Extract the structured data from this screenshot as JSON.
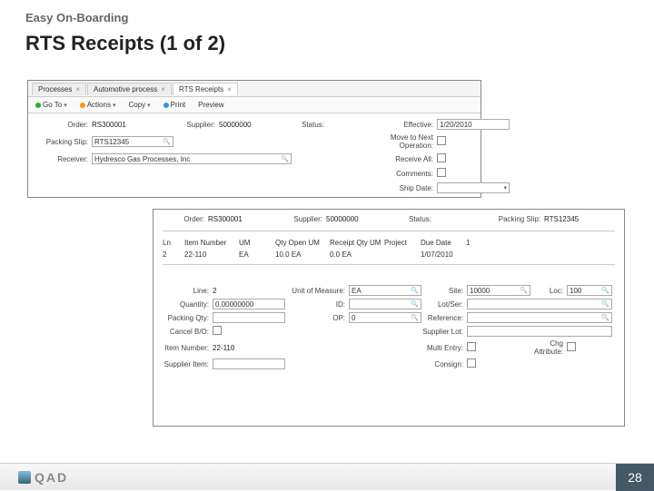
{
  "slide": {
    "header": "Easy On-Boarding",
    "title": "RTS Receipts (1 of 2)"
  },
  "panel1": {
    "tabs": [
      {
        "label": "Processes"
      },
      {
        "label": "Automotive process"
      },
      {
        "label": "RTS Receipts"
      }
    ],
    "toolbar": {
      "goto": "Go To",
      "actions": "Actions",
      "copy": "Copy",
      "print": "Print",
      "preview": "Preview"
    },
    "fields": {
      "order_lbl": "Order:",
      "order": "RS300001",
      "supplier_lbl": "Supplier:",
      "supplier": "50000000",
      "status_lbl": "Status:",
      "effective_lbl": "Effective:",
      "effective": "1/20/2010",
      "packing_lbl": "Packing Slip:",
      "packing": "RTS12345",
      "move_lbl": "Move to Next Operation:",
      "receiver_lbl": "Receiver:",
      "receiver": "Hydresco Gas Processes, Inc",
      "recvall_lbl": "Receive All:",
      "comments_lbl": "Comments:",
      "shipdate_lbl": "Ship Date:"
    }
  },
  "panel2": {
    "hdr": {
      "order_lbl": "Order:",
      "order": "RS300001",
      "supplier_lbl": "Supplier:",
      "supplier": "50000000",
      "status_lbl": "Status:",
      "packing_lbl": "Packing Slip:",
      "packing": "RTS12345"
    },
    "thead": {
      "ln": "Ln",
      "item": "Item Number",
      "um": "UM",
      "qtyopen": "Qty Open UM",
      "recqty": "Receipt Qty UM",
      "project": "Project",
      "due": "Due Date",
      "one": "1"
    },
    "trow": {
      "ln": "2",
      "item": "22-110",
      "um": "EA",
      "qtyopen": "10.0 EA",
      "recqty": "0.0 EA",
      "project": "",
      "due": "1/07/2010"
    },
    "fields": {
      "line_lbl": "Line:",
      "line": "2",
      "uom_lbl": "Unit of Measure:",
      "uom": "EA",
      "site_lbl": "Site:",
      "site": "10000",
      "loc_lbl": "Loc:",
      "loc": "100",
      "qty_lbl": "Quantity:",
      "qty": "0.00000000",
      "id_lbl": "ID:",
      "lotser_lbl": "Lot/Ser:",
      "packqty_lbl": "Packing Qty:",
      "op_lbl": "OP:",
      "op": "0",
      "ref_lbl": "Reference:",
      "cancel_lbl": "Cancel B/O:",
      "suplot_lbl": "Supplier Lot:",
      "itemno_lbl": "Item Number:",
      "itemno": "22-110",
      "multi_lbl": "Multi Entry:",
      "chgattr_lbl": "Chg Attribute:",
      "supitem_lbl": "Supplier Item:",
      "consign_lbl": "Consign:"
    }
  },
  "footer": {
    "brand": "QAD",
    "page": "28"
  }
}
